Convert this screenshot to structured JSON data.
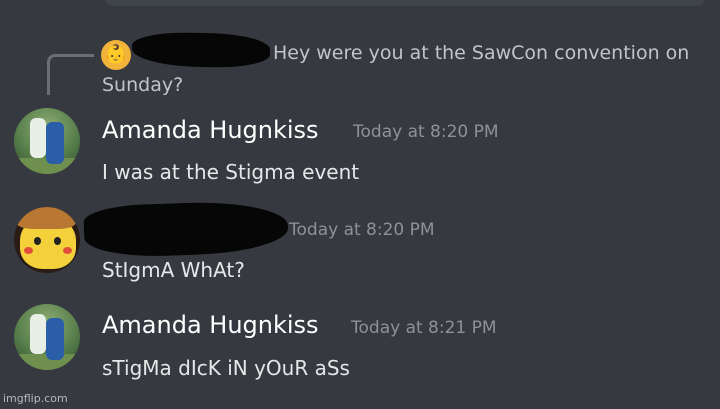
{
  "reply": {
    "avatar_icon": "baby-emoji-icon",
    "avatar_glyph": "👶",
    "text_line1": "Hey were you at the SawCon convention on",
    "text_line2": "Sunday?"
  },
  "messages": [
    {
      "username": "Amanda Hugnkiss",
      "timestamp": "Today at 8:20 PM",
      "content": "I was at the Stigma event"
    },
    {
      "username": "",
      "timestamp": "Today at 8:20 PM",
      "content": "StIgmA WhAt?"
    },
    {
      "username": "Amanda Hugnkiss",
      "timestamp": "Today at 8:21 PM",
      "content": "sTigMa dIcK iN yOuR aSs"
    }
  ],
  "watermark": "imgflip.com"
}
